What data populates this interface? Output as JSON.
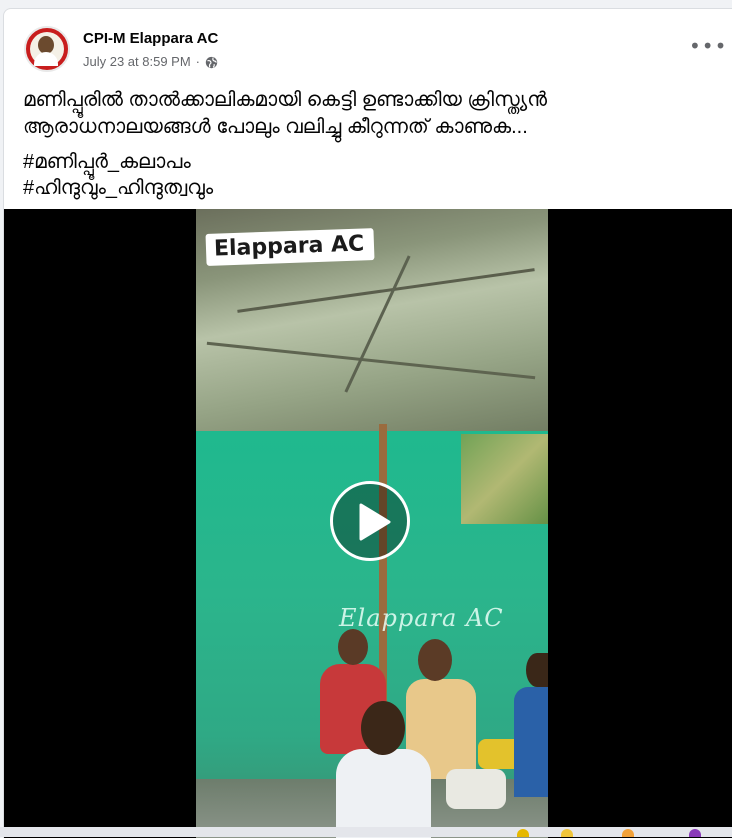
{
  "post": {
    "page_name": "CPI-M Elappara AC",
    "timestamp": "July 23 at 8:59 PM",
    "separator": "·",
    "more_label": "•••",
    "text_line1": "മണിപ്പൂരിൽ താൽക്കാലികമായി കെട്ടി ഉണ്ടാക്കിയ ക്രിസ്ത്യൻ",
    "text_line2": "ആരാധനാലയങ്ങൾ പോലും വലിച്ചു കീറുന്നത് കാണുക...",
    "hashtags": [
      "#മണിപ്പൂർ_കലാപം",
      "#ഹിന്ദുവും_ഹിന്ദുത്വവും"
    ]
  },
  "video": {
    "watermark_top": "Elappara AC",
    "watermark_center": "Elappara AC",
    "play_icon": "play-icon"
  },
  "icons": {
    "globe": "globe-icon",
    "more": "more-options-icon"
  },
  "colors": {
    "avatar_red": "#c81d1d",
    "tent_green": "#2bb58c",
    "meta_gray": "#65676b"
  }
}
